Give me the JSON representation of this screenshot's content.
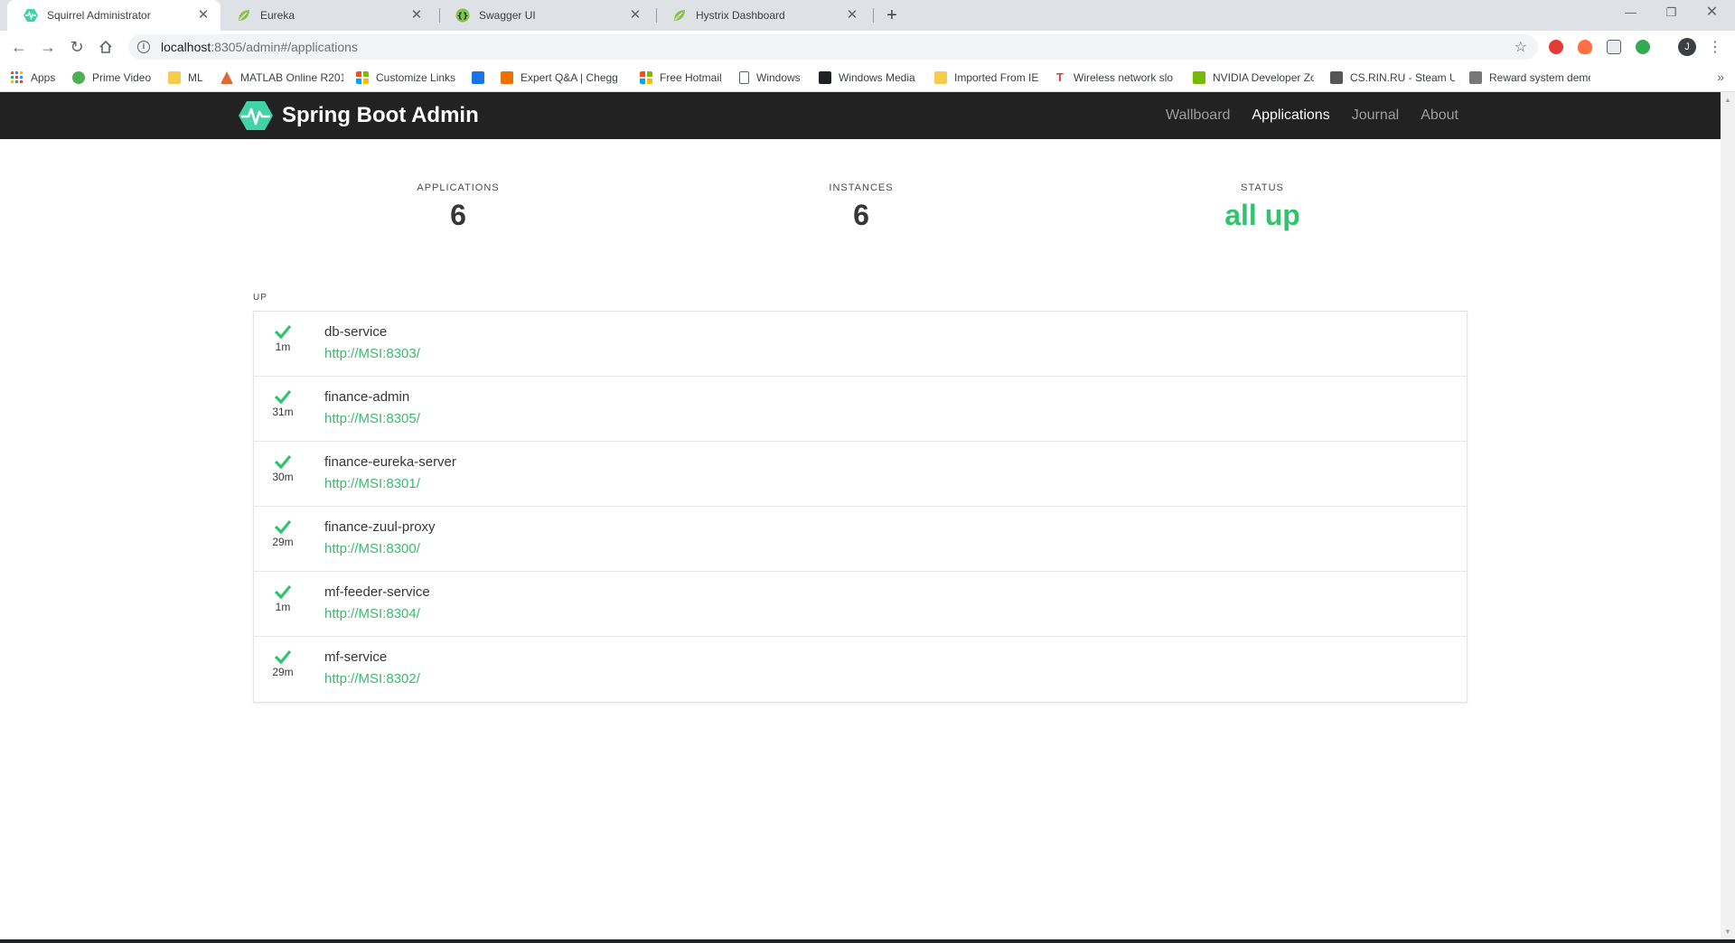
{
  "browser": {
    "tabs": [
      {
        "title": "Squirrel Administrator",
        "active": true,
        "icon": "spring-boot-admin-favicon-icon"
      },
      {
        "title": "Eureka",
        "active": false,
        "icon": "spring-leaf-icon"
      },
      {
        "title": "Swagger UI",
        "active": false,
        "icon": "swagger-icon"
      },
      {
        "title": "Hystrix Dashboard",
        "active": false,
        "icon": "spring-leaf-icon"
      }
    ],
    "address": {
      "host": "localhost",
      "path": ":8305/admin#/applications"
    },
    "bookmarks": [
      {
        "label": "Apps",
        "icon": "apps-grid-icon",
        "color": "#ea4335"
      },
      {
        "label": "Prime Video",
        "icon": "play-icon",
        "color": "#4caf50"
      },
      {
        "label": "ML",
        "icon": "folder-icon",
        "color": "#f7cb4d"
      },
      {
        "label": "MATLAB Online R201",
        "icon": "matlab-icon",
        "color": "#e16737"
      },
      {
        "label": "Customize Links",
        "icon": "windows-icon",
        "color": "#00a4ef"
      },
      {
        "label": "",
        "icon": "media-icon",
        "color": "#1a73e8"
      },
      {
        "label": "Expert Q&A | Chegg",
        "icon": "chegg-icon",
        "color": "#eb7100"
      },
      {
        "label": "Free Hotmail",
        "icon": "windows-icon",
        "color": "#f25022"
      },
      {
        "label": "Windows",
        "icon": "page-icon",
        "color": "#5f6368"
      },
      {
        "label": "Windows Media",
        "icon": "windows-media-icon",
        "color": "#202124"
      },
      {
        "label": "Imported From IE",
        "icon": "folder-icon",
        "color": "#f7cb4d"
      },
      {
        "label": "Wireless network slo",
        "icon": "t-icon",
        "color": "#e53935"
      },
      {
        "label": "NVIDIA Developer Zo",
        "icon": "nvidia-icon",
        "color": "#76b900"
      },
      {
        "label": "CS.RIN.RU - Steam U",
        "icon": "csrin-icon",
        "color": "#555555"
      },
      {
        "label": "Reward system demo",
        "icon": "reward-icon",
        "color": "#555555"
      }
    ]
  },
  "nav": {
    "brand": "Spring Boot Admin",
    "links": [
      {
        "label": "Wallboard",
        "active": false
      },
      {
        "label": "Applications",
        "active": true
      },
      {
        "label": "Journal",
        "active": false
      },
      {
        "label": "About",
        "active": false
      }
    ]
  },
  "summary": {
    "applications": {
      "label": "APPLICATIONS",
      "value": "6"
    },
    "instances": {
      "label": "INSTANCES",
      "value": "6"
    },
    "status": {
      "label": "STATUS",
      "value": "all up"
    }
  },
  "group": {
    "title": "UP",
    "apps": [
      {
        "name": "db-service",
        "url": "http://MSI:8303/",
        "uptime": "1m"
      },
      {
        "name": "finance-admin",
        "url": "http://MSI:8305/",
        "uptime": "31m"
      },
      {
        "name": "finance-eureka-server",
        "url": "http://MSI:8301/",
        "uptime": "30m"
      },
      {
        "name": "finance-zuul-proxy",
        "url": "http://MSI:8300/",
        "uptime": "29m"
      },
      {
        "name": "mf-feeder-service",
        "url": "http://MSI:8304/",
        "uptime": "1m"
      },
      {
        "name": "mf-service",
        "url": "http://MSI:8302/",
        "uptime": "29m"
      }
    ]
  },
  "colors": {
    "brand_green": "#42d3a5",
    "status_up": "#33c36f",
    "navbar": "#222222"
  }
}
